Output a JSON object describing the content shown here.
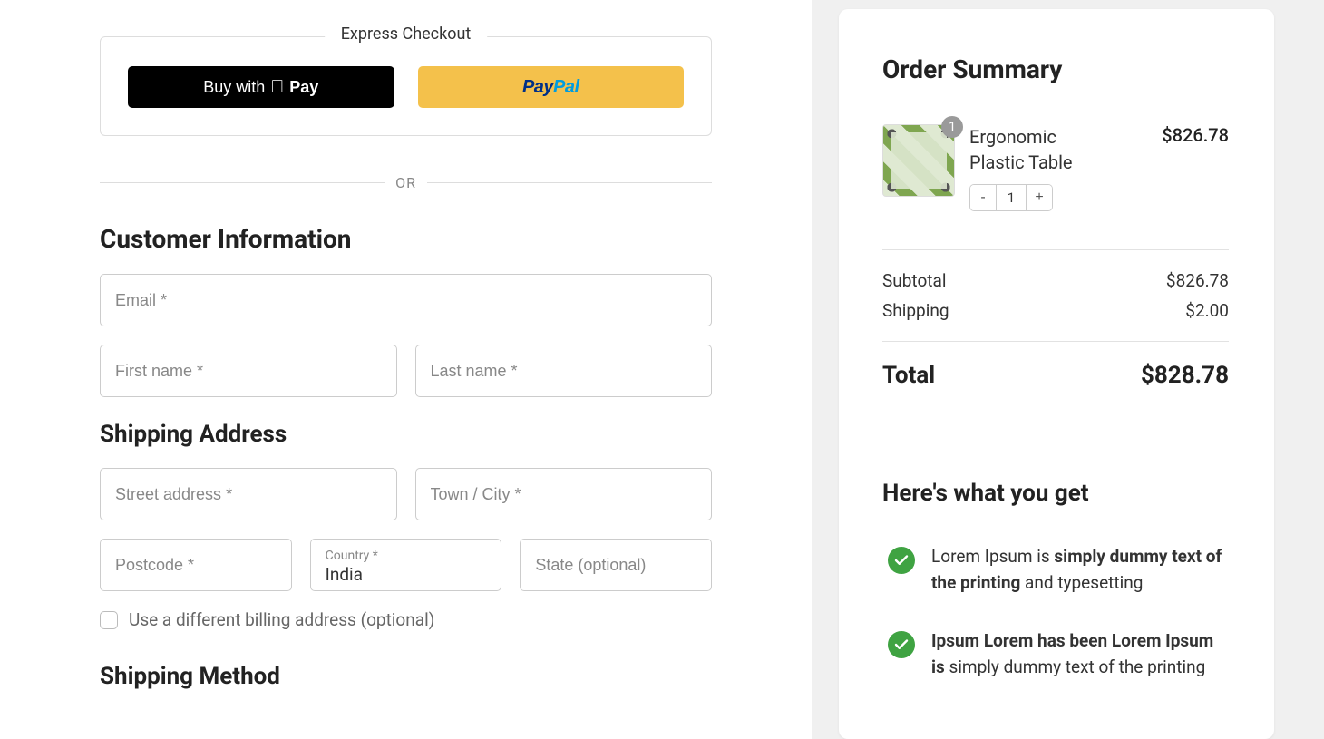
{
  "express": {
    "legend": "Express Checkout",
    "apple_pay_prefix": "Buy with ",
    "apple_pay_brand": "Pay",
    "paypal_pay": "Pay",
    "paypal_pal": "Pal",
    "or": "OR"
  },
  "customer": {
    "title": "Customer Information",
    "email_placeholder": "Email *",
    "first_name_placeholder": "First name *",
    "last_name_placeholder": "Last name *"
  },
  "shipping": {
    "title": "Shipping Address",
    "street_placeholder": "Street address *",
    "city_placeholder": "Town / City *",
    "postcode_placeholder": "Postcode *",
    "country_label": "Country *",
    "country_value": "India",
    "state_placeholder": "State (optional)",
    "billing_checkbox": "Use a different billing address (optional)"
  },
  "shipping_method": {
    "title": "Shipping Method"
  },
  "summary": {
    "title": "Order Summary",
    "item": {
      "name": "Ergonomic Plastic Table",
      "price": "$826.78",
      "qty_badge": "1",
      "qty": "1"
    },
    "subtotal_label": "Subtotal",
    "subtotal_value": "$826.78",
    "shipping_label": "Shipping",
    "shipping_value": "$2.00",
    "total_label": "Total",
    "total_value": "$828.78"
  },
  "benefits": {
    "title": "Here's what you get",
    "item1_pre": "Lorem Ipsum is ",
    "item1_bold": "simply dummy text of the printing",
    "item1_post": " and typesetting",
    "item2_bold": "Ipsum Lorem has been Lorem Ipsum is",
    "item2_post": " simply dummy text of the printing"
  }
}
